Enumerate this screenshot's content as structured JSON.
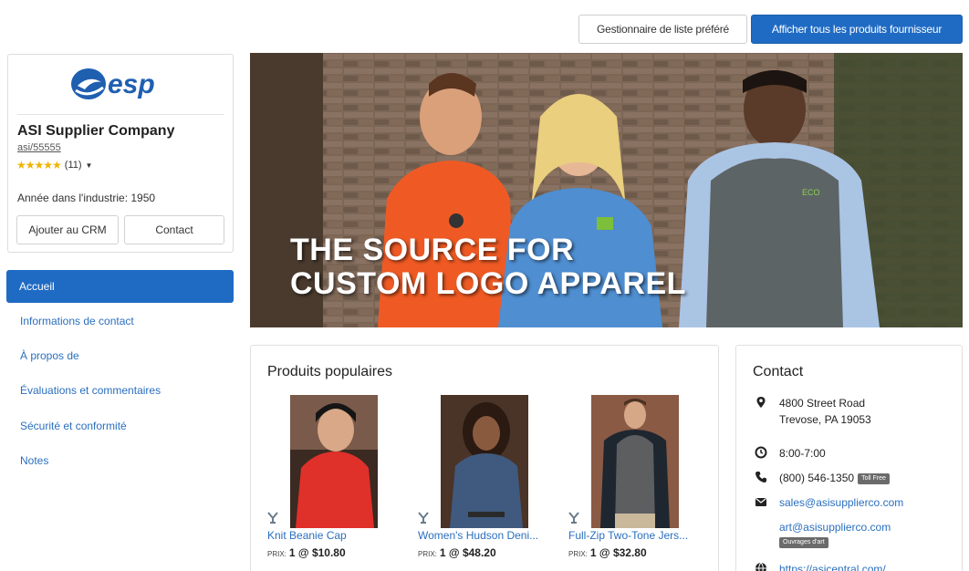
{
  "header": {
    "favorites_button": "Gestionnaire de liste préféré",
    "all_products_button": "Afficher tous les produits fournisseur"
  },
  "supplier": {
    "logo_text": "esp",
    "name": "ASI Supplier Company",
    "asi_number": "asi/55555",
    "rating_stars": "★★★★★",
    "rating_count": "(11)",
    "industry_line": "Année dans l'industrie: 1950",
    "add_crm_button": "Ajouter au CRM",
    "contact_button": "Contact"
  },
  "nav": {
    "items": [
      {
        "label": "Accueil",
        "active": true
      },
      {
        "label": "Informations de contact",
        "active": false
      },
      {
        "label": "À propos de",
        "active": false
      },
      {
        "label": "Évaluations et commentaires",
        "active": false
      },
      {
        "label": "Sécurité et conformité",
        "active": false
      },
      {
        "label": "Notes",
        "active": false
      }
    ]
  },
  "banner": {
    "line1": "THE SOURCE FOR",
    "line2": "CUSTOM LOGO APPAREL"
  },
  "products": {
    "title": "Produits populaires",
    "price_label": "PRIX:",
    "items": [
      {
        "name": "Knit Beanie Cap",
        "price": "1 @ $10.80"
      },
      {
        "name": "Women's Hudson Deni...",
        "price": "1 @ $48.20"
      },
      {
        "name": "Full-Zip Two-Tone Jers...",
        "price": "1 @ $32.80"
      }
    ]
  },
  "contact": {
    "title": "Contact",
    "address_line1": "4800 Street Road",
    "address_line2": "Trevose, PA 19053",
    "hours": "8:00-7:00",
    "phone": "(800) 546-1350",
    "phone_badge": "Toll Free",
    "email_sales": "sales@asisupplierco.com",
    "email_art": "art@asisupplierco.com",
    "art_badge": "Ouvrages d'art",
    "website": "https://asicentral.com/"
  },
  "colors": {
    "primary": "#1f6bc4",
    "link": "#2a6fbe",
    "star": "#f0b400"
  }
}
